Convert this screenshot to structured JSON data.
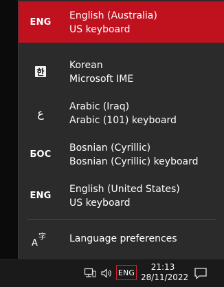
{
  "languages": [
    {
      "code": "ENG",
      "name": "English (Australia)",
      "keyboard": "US keyboard",
      "selected": true
    },
    {
      "code": "한",
      "name": "Korean",
      "keyboard": "Microsoft IME",
      "selected": false
    },
    {
      "code": "ع",
      "name": "Arabic (Iraq)",
      "keyboard": "Arabic (101) keyboard",
      "selected": false
    },
    {
      "code": "БОС",
      "name": "Bosnian (Cyrillic)",
      "keyboard": "Bosnian (Cyrillic) keyboard",
      "selected": false
    },
    {
      "code": "ENG",
      "name": "English (United States)",
      "keyboard": "US keyboard",
      "selected": false
    }
  ],
  "preferences": {
    "label": "Language preferences",
    "icon": "language-preferences-icon",
    "icon_glyph": "字"
  },
  "taskbar": {
    "network_icon": "network-icon",
    "volume_icon": "volume-icon",
    "language_indicator": "ENG",
    "time": "21:13",
    "date": "28/11/2022",
    "notification_icon": "action-center-icon"
  },
  "colors": {
    "accent": "#c0111f",
    "flyout_bg": "#2b2b2b",
    "taskbar_bg": "#1a1a1a",
    "indicator_border": "#d0202e"
  }
}
